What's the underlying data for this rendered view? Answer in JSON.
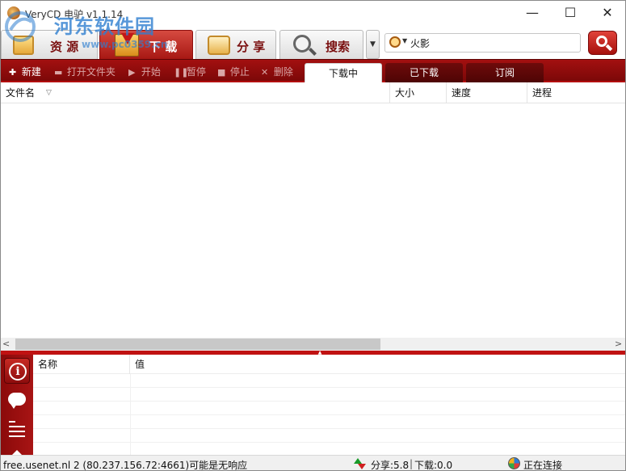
{
  "window": {
    "title": "VeryCD 电驴 v1.1.14",
    "controls": {
      "minimize": "—",
      "maximize": "☐",
      "close": "✕"
    }
  },
  "watermark": {
    "text": "河东软件园",
    "url": "www.pc0359.cn"
  },
  "main_tabs": [
    {
      "label": "资 源",
      "icon": "box-icon"
    },
    {
      "label": "下 载",
      "icon": "download-box-icon",
      "active": true
    },
    {
      "label": "分 享",
      "icon": "share-box-icon"
    },
    {
      "label": "搜索",
      "icon": "magnifier-icon"
    }
  ],
  "search": {
    "value": "火影",
    "type_icon": "search-type-icon",
    "go_icon": "search-icon"
  },
  "toolbar": {
    "new": "新建",
    "open_folder": "打开文件夹",
    "start": "开始",
    "pause": "暂停",
    "stop": "停止",
    "delete": "删除"
  },
  "sub_tabs": [
    {
      "label": "下载中",
      "active": true
    },
    {
      "label": "已下载"
    },
    {
      "label": "订阅"
    }
  ],
  "file_list": {
    "columns": [
      "文件名",
      "大小",
      "速度",
      "进程"
    ],
    "sort_indicator": "▽",
    "rows": []
  },
  "properties": {
    "columns": [
      "名称",
      "值"
    ],
    "rows": []
  },
  "side_panel": {
    "buttons": [
      "info-icon",
      "chat-icon",
      "list-icon"
    ]
  },
  "status": {
    "server": "free.usenet.nl 2 (80.237.156.72:4661)可能是无响应",
    "share": "分享:5.8",
    "separator": "|",
    "download": "下载:0.0",
    "connection": "正在连接"
  },
  "colors": {
    "accent_red": "#a31010",
    "toolbar_dark": "#7c0808",
    "tab_text": "#7a1010"
  }
}
